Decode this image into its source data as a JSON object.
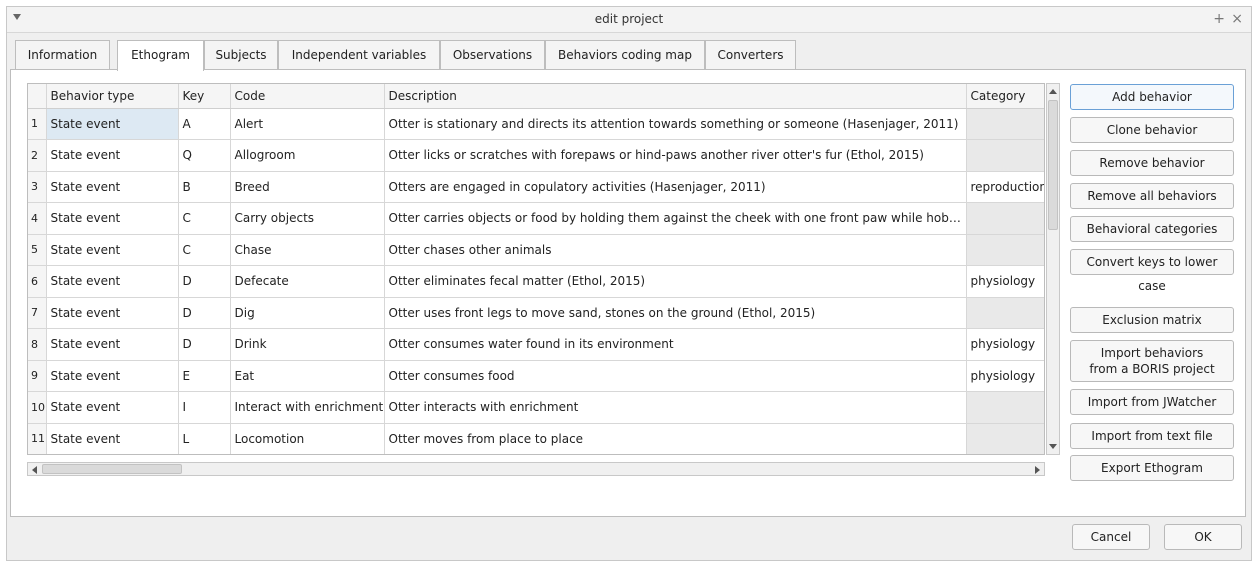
{
  "window": {
    "title": "edit project"
  },
  "tabs": [
    {
      "label": "Information"
    },
    {
      "label": "Ethogram"
    },
    {
      "label": "Subjects"
    },
    {
      "label": "Independent variables"
    },
    {
      "label": "Observations"
    },
    {
      "label": "Behaviors coding map"
    },
    {
      "label": "Converters"
    }
  ],
  "table": {
    "headers": [
      "Behavior type",
      "Key",
      "Code",
      "Description",
      "Category"
    ],
    "rows": [
      {
        "num": "1",
        "type": "State event",
        "key": "A",
        "code": "Alert",
        "description": "Otter is stationary and directs its attention towards something or someone (Hasenjager, 2011)",
        "category": ""
      },
      {
        "num": "2",
        "type": "State event",
        "key": "Q",
        "code": "Allogroom",
        "description": "Otter licks or scratches with forepaws or hind-paws another river otter's fur (Ethol, 2015)",
        "category": ""
      },
      {
        "num": "3",
        "type": "State event",
        "key": "B",
        "code": "Breed",
        "description": "Otters are engaged in copulatory activities (Hasenjager, 2011)",
        "category": "reproduction"
      },
      {
        "num": "4",
        "type": "State event",
        "key": "C",
        "code": "Carry objects",
        "description": "Otter carries objects or food by holding them against the cheek with one front paw while hob…",
        "category": ""
      },
      {
        "num": "5",
        "type": "State event",
        "key": "C",
        "code": "Chase",
        "description": "Otter chases other animals",
        "category": ""
      },
      {
        "num": "6",
        "type": "State event",
        "key": "D",
        "code": "Defecate",
        "description": "Otter eliminates fecal matter (Ethol, 2015)",
        "category": "physiology"
      },
      {
        "num": "7",
        "type": "State event",
        "key": "D",
        "code": "Dig",
        "description": "Otter uses front legs to move sand, stones on the ground (Ethol, 2015)",
        "category": ""
      },
      {
        "num": "8",
        "type": "State event",
        "key": "D",
        "code": "Drink",
        "description": "Otter consumes water found in its environment",
        "category": "physiology"
      },
      {
        "num": "9",
        "type": "State event",
        "key": "E",
        "code": "Eat",
        "description": "Otter consumes food",
        "category": "physiology"
      },
      {
        "num": "10",
        "type": "State event",
        "key": "I",
        "code": "Interact with enrichment",
        "description": "Otter interacts with enrichment",
        "category": ""
      },
      {
        "num": "11",
        "type": "State event",
        "key": "L",
        "code": "Locomotion",
        "description": "Otter moves from place to place",
        "category": ""
      }
    ]
  },
  "side_buttons": [
    {
      "label": "Add behavior"
    },
    {
      "label": "Clone behavior"
    },
    {
      "label": "Remove behavior"
    },
    {
      "label": "Remove all behaviors"
    },
    {
      "label": "Behavioral categories"
    },
    {
      "label": "Convert keys to lower case"
    },
    {
      "label": "Exclusion matrix"
    },
    {
      "label": "Import behaviors\nfrom a BORIS project"
    },
    {
      "label": "Import from JWatcher"
    },
    {
      "label": "Import from text file"
    },
    {
      "label": "Export Ethogram"
    }
  ],
  "footer": {
    "cancel_label": "Cancel",
    "ok_label": "OK"
  }
}
